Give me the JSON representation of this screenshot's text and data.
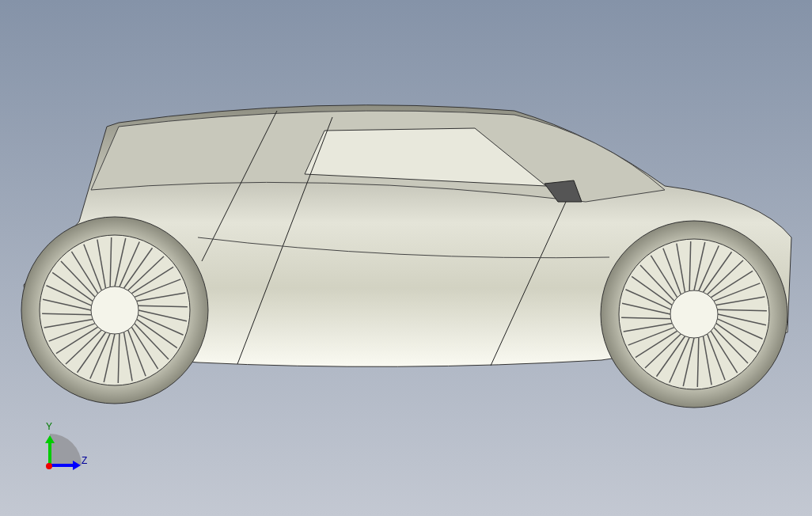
{
  "triad": {
    "axes": [
      {
        "label": "Y",
        "color": "#00cc00"
      },
      {
        "label": "Z",
        "color": "#0000ff"
      }
    ]
  }
}
